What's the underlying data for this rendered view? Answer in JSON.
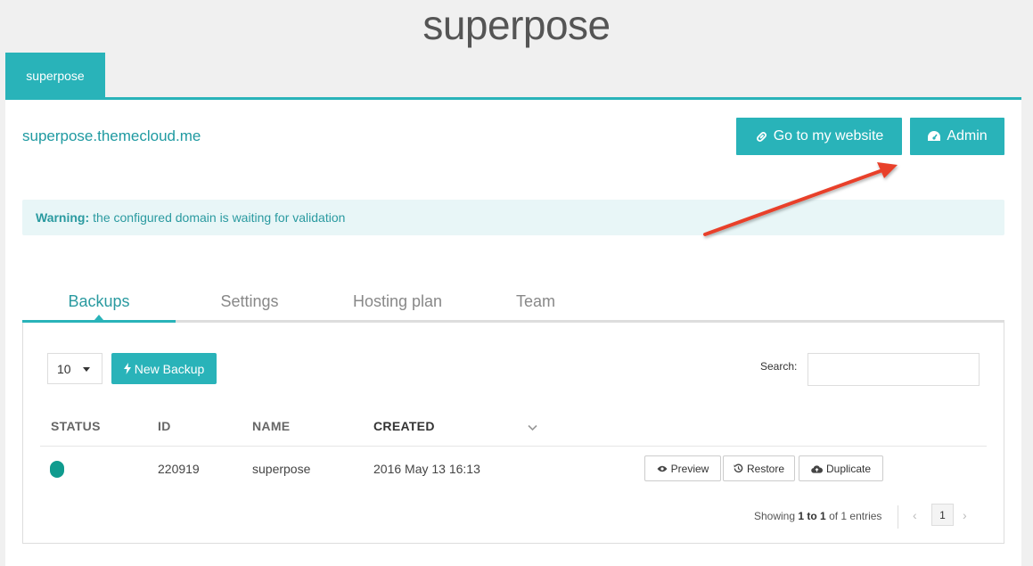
{
  "brand": "superpose",
  "site_tab": "superpose",
  "domain": "superpose.themecloud.me",
  "buttons": {
    "goto": "Go to my website",
    "admin": "Admin"
  },
  "alert": {
    "label": "Warning:",
    "text": "the configured domain is waiting for validation"
  },
  "tabs": [
    "Backups",
    "Settings",
    "Hosting plan",
    "Team"
  ],
  "table": {
    "page_length": "10",
    "new_backup": "New Backup",
    "search_label": "Search:",
    "columns": [
      "STATUS",
      "ID",
      "NAME",
      "CREATED"
    ],
    "rows": [
      {
        "status_color": "#0f9b8e",
        "id": "220919",
        "name": "superpose",
        "created": "2016 May 13 16:13",
        "actions": [
          "Preview",
          "Restore",
          "Duplicate"
        ]
      }
    ],
    "info": {
      "prefix": "Showing",
      "range": "1 to 1",
      "suffix": "of 1 entries"
    },
    "current_page": "1"
  },
  "colors": {
    "accent": "#29b3b9",
    "alert_bg": "#e8f6f7",
    "arrow": "#e8412c"
  }
}
